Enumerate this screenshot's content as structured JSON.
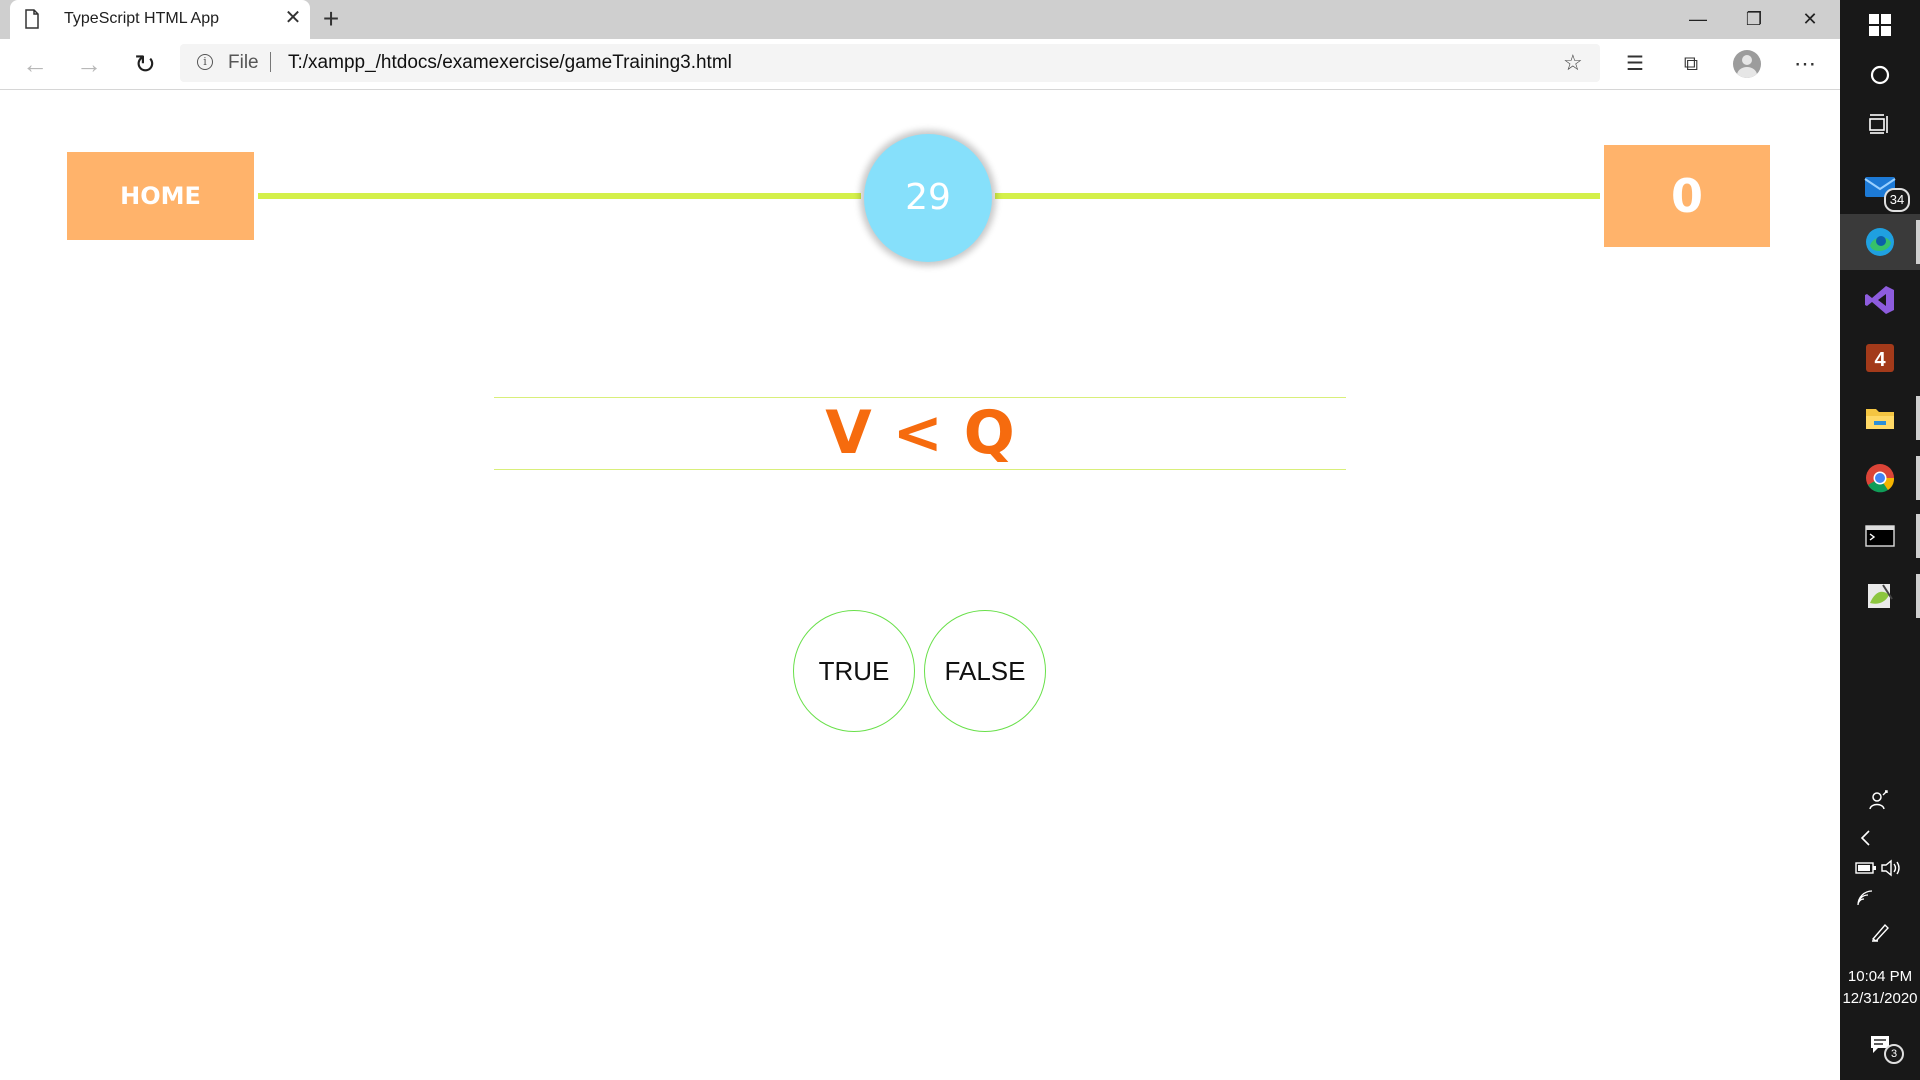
{
  "browser": {
    "tab_title": "TypeScript HTML App",
    "url_scheme": "File",
    "url": "T:/xampp_/htdocs/examexercise/gameTraining3.html"
  },
  "game": {
    "home_label": "HOME",
    "timer": "29",
    "score": "0",
    "question": "V < Q",
    "true_label": "TRUE",
    "false_label": "FALSE"
  },
  "taskbar": {
    "mail_badge": "34",
    "notification_badge": "3",
    "time": "10:04 PM",
    "date": "12/31/2020"
  },
  "colors": {
    "accent_orange": "#ffb36b",
    "question_orange": "#f66b0e",
    "timer_blue": "#86e0fb",
    "track_green": "#d4f04a",
    "button_border": "#69e04a"
  }
}
